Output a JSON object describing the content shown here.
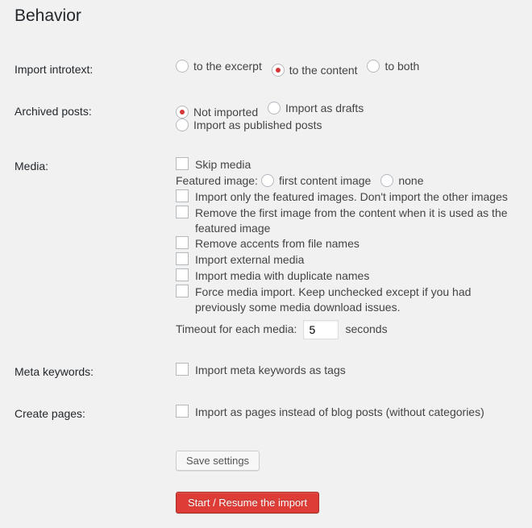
{
  "section_title": "Behavior",
  "rows": {
    "introtext": {
      "label": "Import introtext:",
      "options": [
        "to the excerpt",
        "to the content",
        "to both"
      ],
      "selected": 1
    },
    "archived": {
      "label": "Archived posts:",
      "options": [
        "Not imported",
        "Import as drafts",
        "Import as published posts"
      ],
      "selected": 0
    },
    "media": {
      "label": "Media:",
      "skip": "Skip media",
      "featured_label": "Featured image:",
      "featured_options": [
        "first content image",
        "none"
      ],
      "only_featured": "Import only the featured images. Don't import the other images",
      "remove_first": "Remove the first image from the content when it is used as the featured image",
      "remove_accents": "Remove accents from file names",
      "external": "Import external media",
      "duplicates": "Import media with duplicate names",
      "force": "Force media import. Keep unchecked except if you had previously some media download issues.",
      "timeout_label": "Timeout for each media:",
      "timeout_value": "5",
      "timeout_suffix": "seconds"
    },
    "meta": {
      "label": "Meta keywords:",
      "text": "Import meta keywords as tags"
    },
    "pages": {
      "label": "Create pages:",
      "text": "Import as pages instead of blog posts (without categories)"
    }
  },
  "buttons": {
    "save": "Save settings",
    "start": "Start / Resume the import"
  }
}
